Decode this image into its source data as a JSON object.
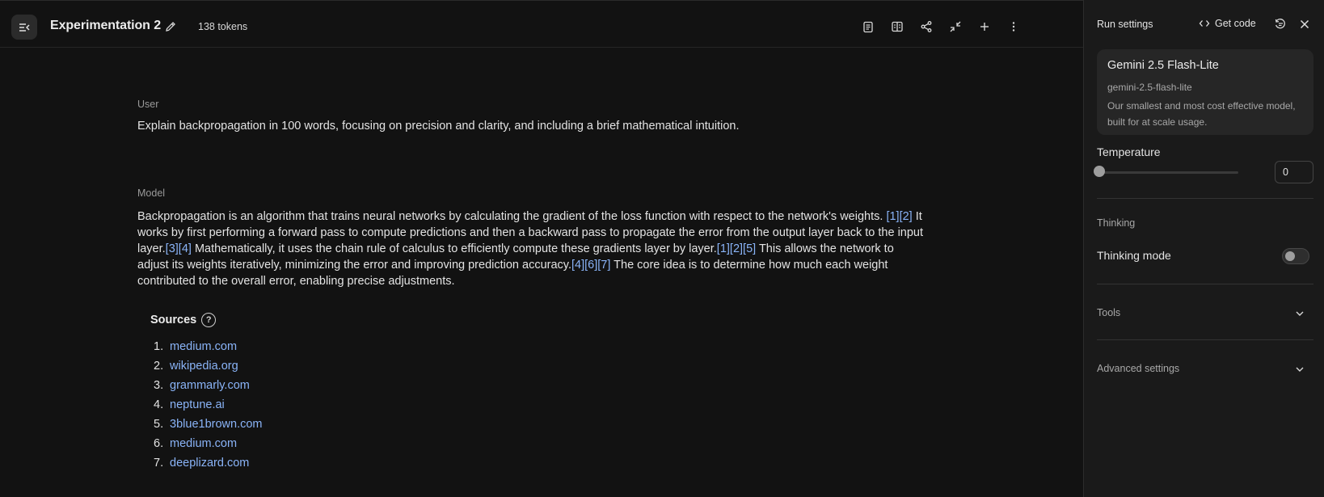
{
  "header": {
    "title": "Experimentation 2",
    "tokens": "138 tokens",
    "icons": [
      "menu-collapse-icon",
      "edit-icon",
      "clipboard-icon",
      "compare-icon",
      "share-icon",
      "compress-icon",
      "plus-icon",
      "more-vert-icon"
    ]
  },
  "conversation": {
    "user_label": "User",
    "user_text": "Explain backpropagation in 100 words, focusing on precision and clarity, and including a brief mathematical intuition.",
    "model_label": "Model",
    "model_segments": [
      {
        "t": "Backpropagation is an algorithm that trains neural networks by calculating the gradient of the loss function with respect to the network's weights. "
      },
      {
        "c": "[1]"
      },
      {
        "c": "[2]"
      },
      {
        "t": " It works by first performing a forward pass to compute predictions and then a backward pass to propagate the error from the output layer back to the input layer."
      },
      {
        "c": "[3]"
      },
      {
        "c": "[4]"
      },
      {
        "t": " Mathematically, it uses the chain rule of calculus to efficiently compute these gradients layer by layer."
      },
      {
        "c": "[1]"
      },
      {
        "c": "[2]"
      },
      {
        "c": "[5]"
      },
      {
        "t": " This allows the network to adjust its weights iteratively, minimizing the error and improving prediction accuracy."
      },
      {
        "c": "[4]"
      },
      {
        "c": "[6]"
      },
      {
        "c": "[7]"
      },
      {
        "t": " The core idea is to determine how much each weight contributed to the overall error, enabling precise adjustments."
      }
    ],
    "sources_title": "Sources",
    "sources": [
      {
        "num": "1.",
        "label": "medium.com"
      },
      {
        "num": "2.",
        "label": "wikipedia.org"
      },
      {
        "num": "3.",
        "label": "grammarly.com"
      },
      {
        "num": "4.",
        "label": "neptune.ai"
      },
      {
        "num": "5.",
        "label": "3blue1brown.com"
      },
      {
        "num": "6.",
        "label": "medium.com"
      },
      {
        "num": "7.",
        "label": "deeplizard.com"
      }
    ]
  },
  "panel": {
    "title": "Run settings",
    "get_code": "Get code",
    "model_name": "Gemini 2.5 Flash-Lite",
    "model_id": "gemini-2.5-flash-lite",
    "model_desc": "Our smallest and most cost effective model, built for at scale usage.",
    "temperature_label": "Temperature",
    "temperature_value": "0",
    "temperature_fraction": 0,
    "thinking_section": "Thinking",
    "thinking_mode_label": "Thinking mode",
    "thinking_mode_on": false,
    "tools_label": "Tools",
    "advanced_label": "Advanced settings"
  },
  "colors": {
    "background": "#121212",
    "panel_background": "#1a1a1a",
    "link": "#8ab4f8",
    "text": "#e3e3e3"
  }
}
